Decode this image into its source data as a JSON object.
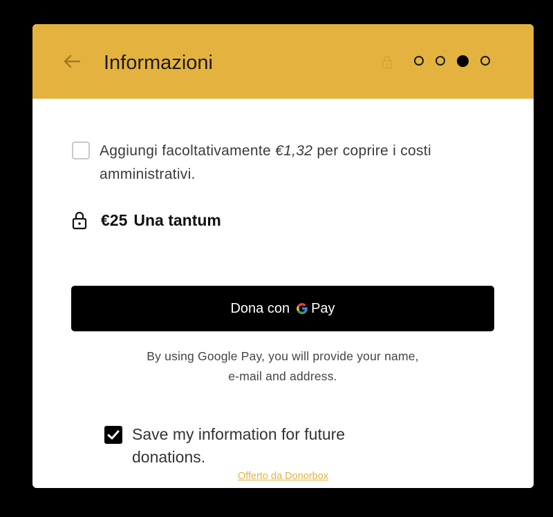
{
  "header": {
    "title": "Informazioni",
    "back_icon": "arrow-left-icon",
    "lock_icon": "lock-icon",
    "steps_total": 4,
    "steps_active": 3
  },
  "fee": {
    "prefix": "Aggiungi facoltativamente ",
    "amount": "€1,32",
    "suffix": " per coprire i costi amministrativi.",
    "checked": false
  },
  "summary": {
    "amount": "€25",
    "frequency": "Una tantum"
  },
  "gpay_button": {
    "prefix": "Dona con",
    "pay_label": "Pay"
  },
  "disclaimer": {
    "line1": "By using Google Pay, you will provide your name,",
    "line2": "e-mail and address."
  },
  "save_info": {
    "label": "Save my information for future donations.",
    "checked": true
  },
  "footer": {
    "powered_by": "Offerto da Donorbox"
  },
  "colors": {
    "accent": "#e4b33f",
    "button_bg": "#000000",
    "text": "#333333"
  }
}
